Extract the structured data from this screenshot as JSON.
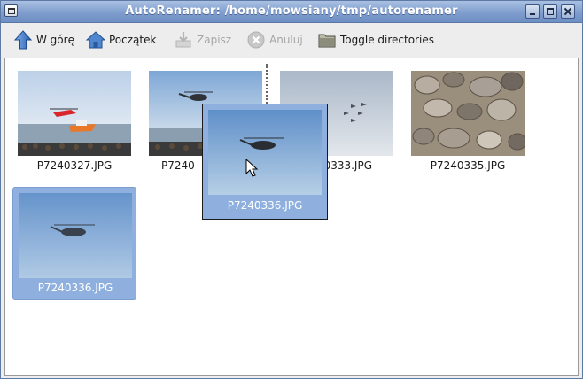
{
  "window": {
    "title": "AutoRenamer: /home/mowsiany/tmp/autorenamer"
  },
  "toolbar": {
    "up_label": "W górę",
    "home_label": "Początek",
    "save_label": "Zapisz",
    "cancel_label": "Anuluj",
    "toggle_label": "Toggle directories"
  },
  "files": [
    {
      "name": "P7240327.JPG",
      "scene": "rescue-boat-helicopter"
    },
    {
      "name": "P7240",
      "scene": "helicopter-over-sea"
    },
    {
      "name": "0333.JPG",
      "scene": "formation-aircraft"
    },
    {
      "name": "P7240335.JPG",
      "scene": "pebbles"
    },
    {
      "name": "P7240336.JPG",
      "scene": "helicopter-sky",
      "selected": true
    }
  ],
  "drag": {
    "name": "P7240336.JPG"
  },
  "colors": {
    "titlebar": "#7f9dcd",
    "selection": "#8fb0de",
    "up_arrow": "#3a72c4"
  },
  "icons": {
    "up": "arrow-up-icon",
    "home": "home-icon",
    "save": "save-icon",
    "cancel": "cancel-icon",
    "toggle": "folder-icon"
  }
}
